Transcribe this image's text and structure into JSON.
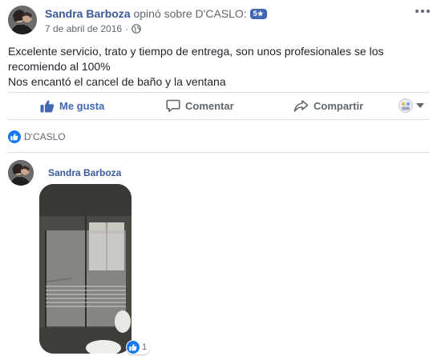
{
  "post": {
    "author": "Sandra Barboza",
    "verb": "opinó sobre",
    "page_name": "D'CASLO:",
    "rating_badge": "5★",
    "date": "7 de abril de 2016",
    "body_lines": [
      "Excelente servicio, trato y tiempo de entrega, son unos profesionales se los",
      "recomiendo al 100%",
      "Nos encantó el cancel de baño y la ventana"
    ]
  },
  "actions": {
    "like_label": "Me gusta",
    "comment_label": "Comentar",
    "share_label": "Compartir"
  },
  "reactions": {
    "liker": "D'CASLO"
  },
  "comment": {
    "author": "Sandra Barboza",
    "photo_reaction_count": "1"
  },
  "colors": {
    "link_blue": "#385898",
    "like_blue": "#4267b2",
    "badge_blue": "#4267b2",
    "secondary_text": "#606770",
    "divider": "#dadde1"
  },
  "icons": [
    "more-options-icon",
    "globe-icon",
    "thumbs-up-icon",
    "comment-icon",
    "share-icon",
    "page-avatar-icon",
    "chevron-down-icon"
  ]
}
